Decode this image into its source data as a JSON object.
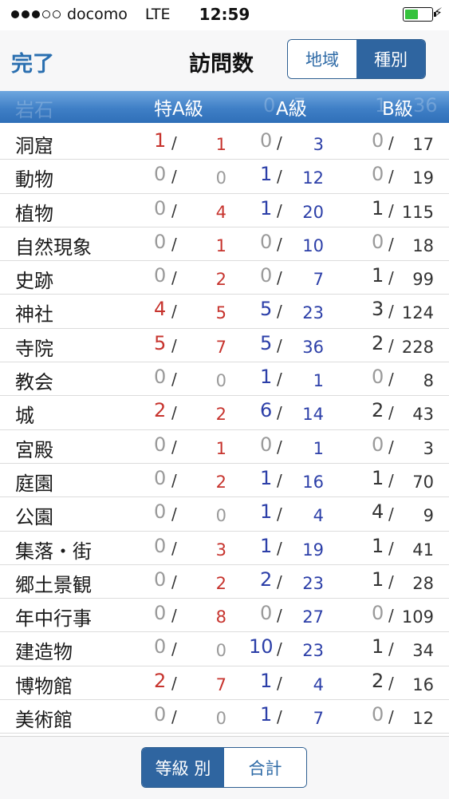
{
  "status": {
    "carrier": "docomo",
    "network": "LTE",
    "time": "12:59"
  },
  "nav": {
    "done_label": "完了",
    "title": "訪問数",
    "segments": [
      {
        "label": "地域",
        "selected": false
      },
      {
        "label": "種別",
        "selected": true
      }
    ]
  },
  "header": {
    "ghost_category": "岩石",
    "ghost_values": [
      "0",
      "7",
      "1",
      "36"
    ],
    "col_a_special": "特A級",
    "col_a": "A級",
    "col_b": "B級"
  },
  "rows": [
    {
      "category": "洞窟",
      "sa": [
        "1",
        "1"
      ],
      "a": [
        "0",
        "3"
      ],
      "b": [
        "0",
        "17"
      ]
    },
    {
      "category": "動物",
      "sa": [
        "0",
        "0"
      ],
      "a": [
        "1",
        "12"
      ],
      "b": [
        "0",
        "19"
      ]
    },
    {
      "category": "植物",
      "sa": [
        "0",
        "4"
      ],
      "a": [
        "1",
        "20"
      ],
      "b": [
        "1",
        "115"
      ]
    },
    {
      "category": "自然現象",
      "sa": [
        "0",
        "1"
      ],
      "a": [
        "0",
        "10"
      ],
      "b": [
        "0",
        "18"
      ]
    },
    {
      "category": "史跡",
      "sa": [
        "0",
        "2"
      ],
      "a": [
        "0",
        "7"
      ],
      "b": [
        "1",
        "99"
      ]
    },
    {
      "category": "神社",
      "sa": [
        "4",
        "5"
      ],
      "a": [
        "5",
        "23"
      ],
      "b": [
        "3",
        "124"
      ]
    },
    {
      "category": "寺院",
      "sa": [
        "5",
        "7"
      ],
      "a": [
        "5",
        "36"
      ],
      "b": [
        "2",
        "228"
      ]
    },
    {
      "category": "教会",
      "sa": [
        "0",
        "0"
      ],
      "a": [
        "1",
        "1"
      ],
      "b": [
        "0",
        "8"
      ]
    },
    {
      "category": "城",
      "sa": [
        "2",
        "2"
      ],
      "a": [
        "6",
        "14"
      ],
      "b": [
        "2",
        "43"
      ]
    },
    {
      "category": "宮殿",
      "sa": [
        "0",
        "1"
      ],
      "a": [
        "0",
        "1"
      ],
      "b": [
        "0",
        "3"
      ]
    },
    {
      "category": "庭園",
      "sa": [
        "0",
        "2"
      ],
      "a": [
        "1",
        "16"
      ],
      "b": [
        "1",
        "70"
      ]
    },
    {
      "category": "公園",
      "sa": [
        "0",
        "0"
      ],
      "a": [
        "1",
        "4"
      ],
      "b": [
        "4",
        "9"
      ]
    },
    {
      "category": "集落・街",
      "sa": [
        "0",
        "3"
      ],
      "a": [
        "1",
        "19"
      ],
      "b": [
        "1",
        "41"
      ]
    },
    {
      "category": "郷土景観",
      "sa": [
        "0",
        "2"
      ],
      "a": [
        "2",
        "23"
      ],
      "b": [
        "1",
        "28"
      ]
    },
    {
      "category": "年中行事",
      "sa": [
        "0",
        "8"
      ],
      "a": [
        "0",
        "27"
      ],
      "b": [
        "0",
        "109"
      ]
    },
    {
      "category": "建造物",
      "sa": [
        "0",
        "0"
      ],
      "a": [
        "10",
        "23"
      ],
      "b": [
        "1",
        "34"
      ]
    },
    {
      "category": "博物館",
      "sa": [
        "2",
        "7"
      ],
      "a": [
        "1",
        "4"
      ],
      "b": [
        "2",
        "16"
      ]
    },
    {
      "category": "美術館",
      "sa": [
        "0",
        "0"
      ],
      "a": [
        "1",
        "7"
      ],
      "b": [
        "0",
        "12"
      ]
    }
  ],
  "bottom": {
    "segments": [
      {
        "label": "等級 別",
        "selected": true
      },
      {
        "label": "合計",
        "selected": false
      }
    ]
  },
  "colors": {
    "accent": "#2f65a0",
    "red": "#c7342e",
    "blue": "#2c3fa8",
    "gray": "#9a9a9a"
  },
  "icons": {
    "signal": "signal-dots-icon",
    "battery": "battery-icon",
    "charging": "bolt-icon"
  }
}
